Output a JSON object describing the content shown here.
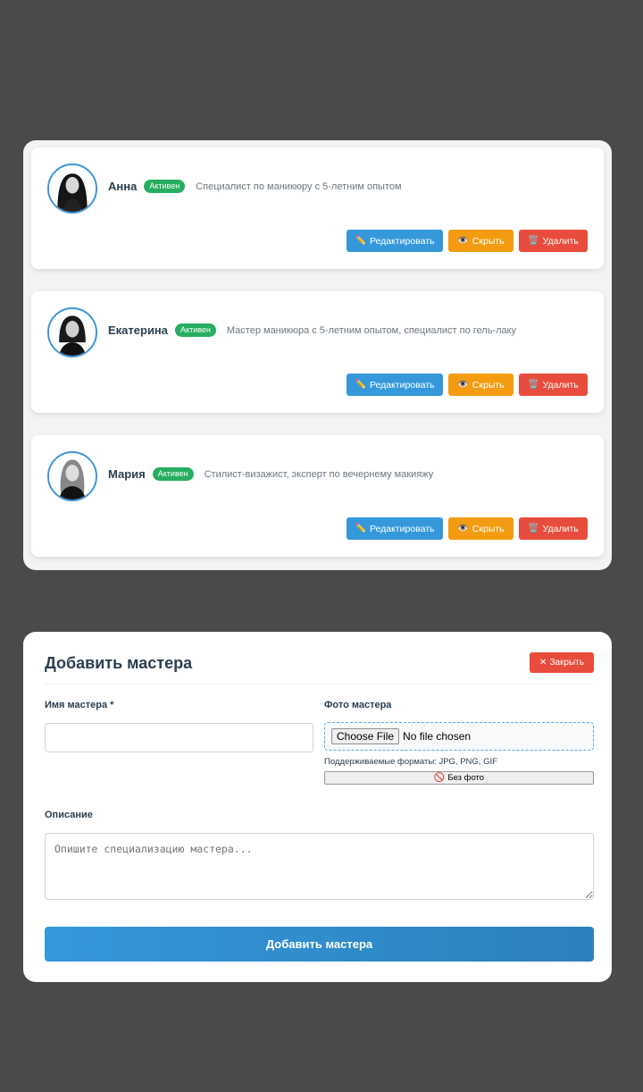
{
  "masters": [
    {
      "name": "Анна",
      "status": "Активен",
      "description": "Специалист по маникюру с 5-летним опытом",
      "actions": {
        "edit": "Редактировать",
        "hide": "Скрыть",
        "delete": "Удалить"
      }
    },
    {
      "name": "Екатерина",
      "status": "Активен",
      "description": "Мастер маникюра с 5-летним опытом, специалист по гель-лаку",
      "actions": {
        "edit": "Редактировать",
        "hide": "Скрыть",
        "delete": "Удалить"
      }
    },
    {
      "name": "Мария",
      "status": "Активен",
      "description": "Стилист-визажист, эксперт по вечернему макияжу",
      "actions": {
        "edit": "Редактировать",
        "hide": "Скрыть",
        "delete": "Удалить"
      }
    }
  ],
  "icons": {
    "edit": "pencil-icon",
    "hide": "eye-icon",
    "delete": "trash-icon",
    "close": "close-icon",
    "no_photo": "prohibited-icon"
  },
  "form": {
    "title": "Добавить мастера",
    "close_label": "Закрыть",
    "name_label": "Имя мастера *",
    "name_value": "",
    "photo_label": "Фото мастера",
    "choose_file_label": "Choose File",
    "no_file_label": "No file chosen",
    "formats_hint": "Поддерживаемые форматы: JPG, PNG, GIF",
    "no_photo_label": "Без фото",
    "description_label": "Описание",
    "description_placeholder": "Опишите специализацию мастера...",
    "submit_label": "Добавить мастера"
  },
  "colors": {
    "background": "#4a4a4a",
    "edit": "#3498db",
    "hide": "#f39c12",
    "delete": "#e74c3c",
    "active": "#27ae60",
    "avatar_border": "#3a95d8"
  }
}
